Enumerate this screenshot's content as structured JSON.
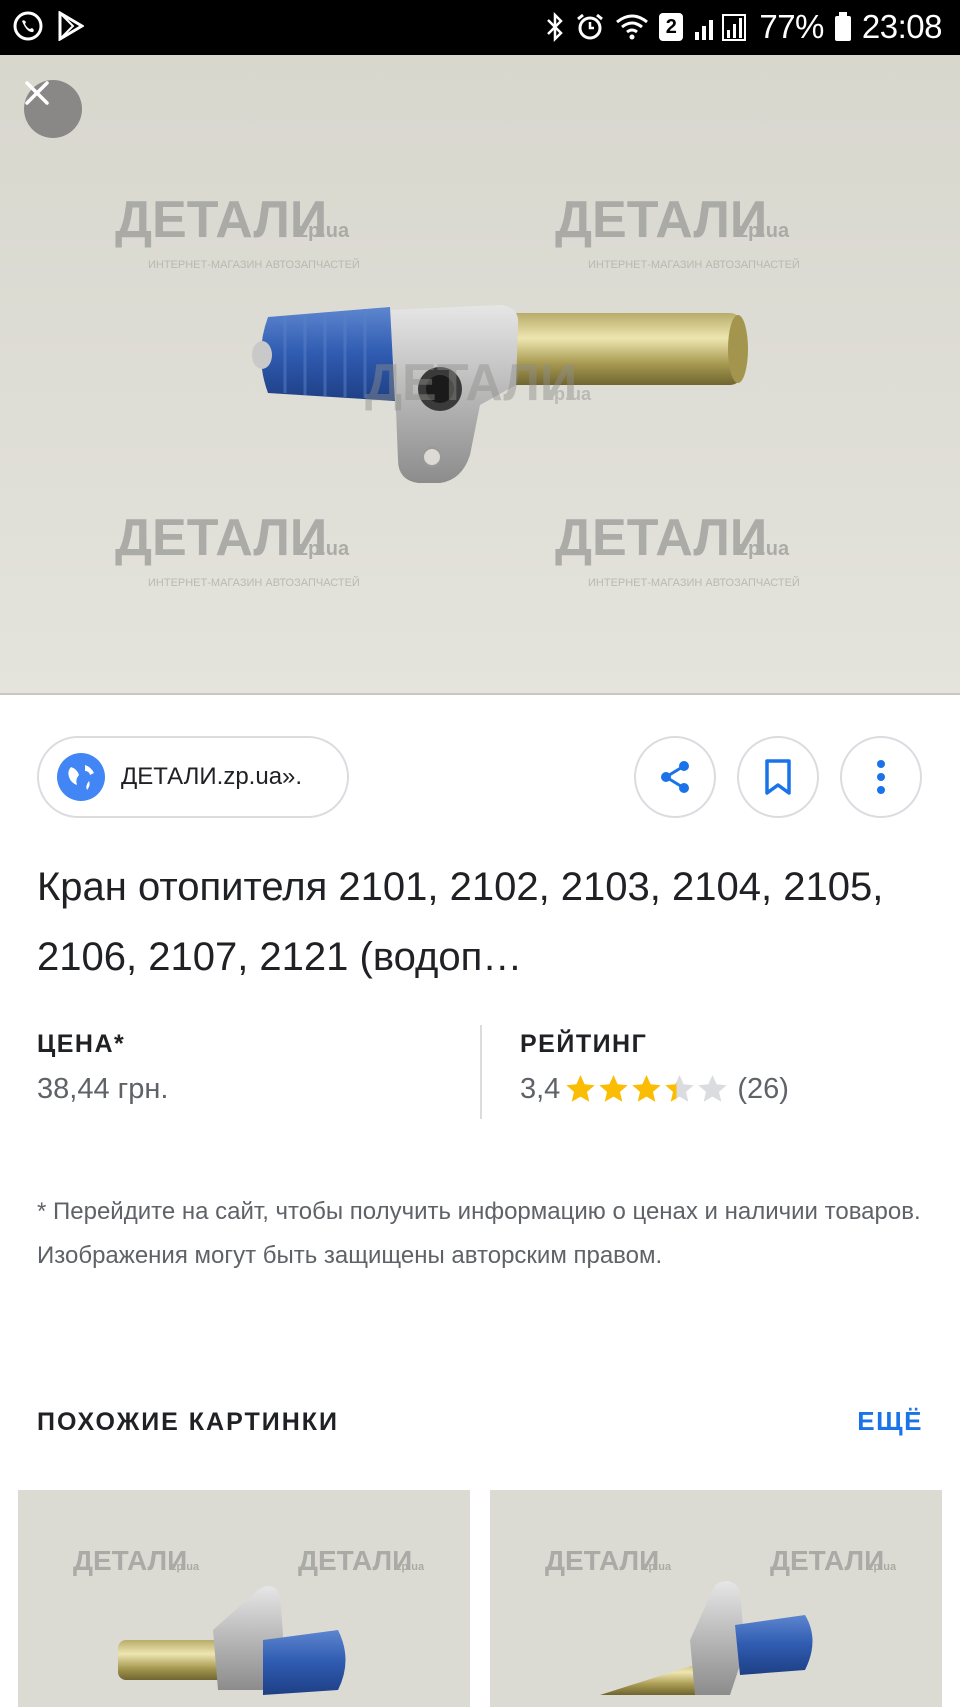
{
  "status_bar": {
    "left_icons": [
      "viber-icon",
      "play-store-icon"
    ],
    "right_icons": [
      "bluetooth-icon",
      "alarm-icon",
      "wifi-icon",
      "signal-icon",
      "battery-icon"
    ],
    "sim_badge": "2",
    "battery": "77%",
    "time": "23:08"
  },
  "hero": {
    "watermark_text": "ДЕТАЛИ",
    "watermark_domain": "zp.ua",
    "watermark_sub": "ИНТЕРНЕТ-МАГАЗИН АВТОЗАПЧАСТЕЙ"
  },
  "source": {
    "label": "ДЕТАЛИ.zp.ua»."
  },
  "title": "Кран отопителя 2101, 2102, 2103, 2104, 2105, 2106, 2107, 2121 (водоп…",
  "price": {
    "label": "ЦЕНА*",
    "value": "38,44 грн."
  },
  "rating": {
    "label": "РЕЙТИНГ",
    "score": "3,4",
    "stars_value": 3.4,
    "stars_max": 5,
    "count": "(26)",
    "star_color": "#fbbc04"
  },
  "disclaimer": "* Перейдите на сайт, чтобы получить информацию о ценах и наличии товаров. Изображения могут быть защищены авторским правом.",
  "similar": {
    "heading": "ПОХОЖИЕ КАРТИНКИ",
    "more": "ЕЩЁ"
  },
  "colors": {
    "accent": "#1a73e8",
    "icon_blue": "#4285f4"
  }
}
